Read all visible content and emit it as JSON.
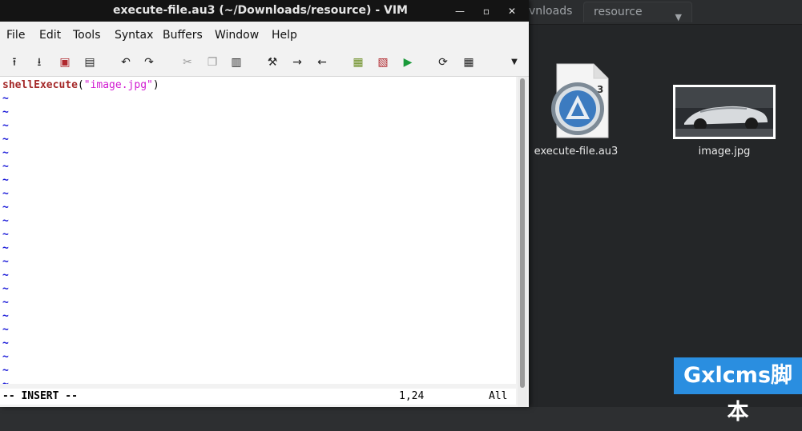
{
  "window": {
    "title": "execute-file.au3 (~/Downloads/resource) - VIM",
    "minimize_icon": "minimize-icon",
    "maximize_icon": "maximize-icon",
    "close_icon": "close-icon"
  },
  "menubar": [
    "File",
    "Edit",
    "Tools",
    "Syntax",
    "Buffers",
    "Window",
    "Help"
  ],
  "toolbar_icons": [
    "open-icon",
    "save-icon",
    "save-all-icon",
    "print-icon",
    "undo-icon",
    "redo-icon",
    "cut-icon",
    "copy-icon",
    "paste-icon",
    "find-replace-icon",
    "find-next-icon",
    "find-prev-icon",
    "load-session-icon",
    "save-session-icon",
    "run-script-icon",
    "make-icon",
    "ctags-icon",
    "more-icon"
  ],
  "editor": {
    "code_fn": "shellExecute",
    "code_open": "(",
    "code_string": "\"image.jpg\"",
    "code_close": ")",
    "empty_line_marker": "~"
  },
  "status": {
    "mode": "-- INSERT --",
    "position": "1,24",
    "scroll": "All"
  },
  "file_manager": {
    "tabs": [
      "vnloads",
      "resource"
    ],
    "files": [
      {
        "name": "execute-file.au3",
        "icon": "autoit-file-icon"
      },
      {
        "name": "image.jpg",
        "icon": "image-thumbnail-icon"
      }
    ]
  },
  "watermark": "Gxlcms脚本"
}
